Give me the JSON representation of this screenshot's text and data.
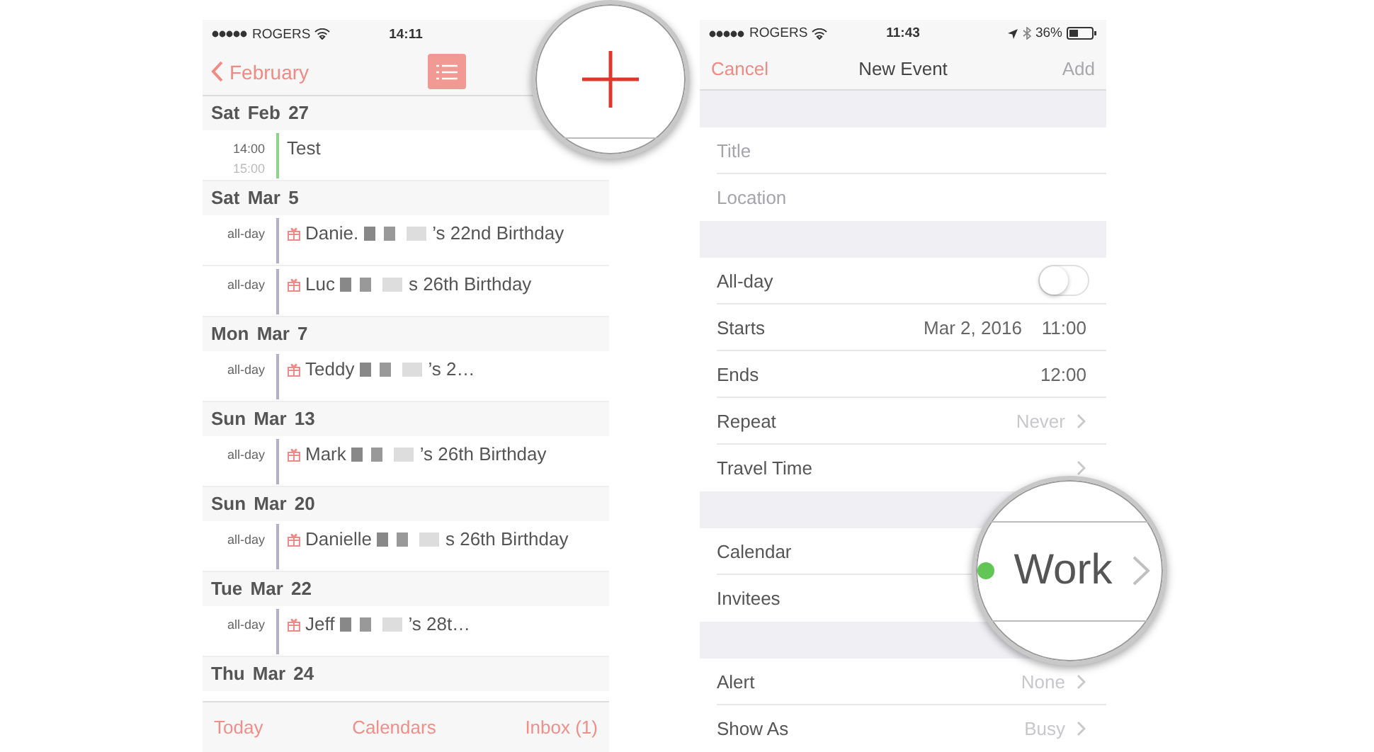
{
  "left_screen": {
    "status_bar": {
      "carrier": "ROGERS",
      "time": "14:11"
    },
    "nav": {
      "back": "February"
    },
    "days": [
      {
        "date": "Sat Feb 27",
        "events": [
          {
            "kind": "timed",
            "start": "14:00",
            "end": "15:00",
            "name": "Test",
            "color": "#8fd48a"
          }
        ]
      },
      {
        "date": "Sat Mar 5",
        "events": [
          {
            "kind": "birthday",
            "time": "all-day",
            "name": "Danie.",
            "rest": "’s 22nd Birthday",
            "color": "#b4aec9"
          },
          {
            "kind": "birthday",
            "time": "all-day",
            "name": "Luc",
            "rest": "s 26th Birthday",
            "color": "#b4aec9"
          }
        ]
      },
      {
        "date": "Mon Mar 7",
        "events": [
          {
            "kind": "birthday",
            "time": "all-day",
            "name": "Teddy",
            "rest": "’s 2…",
            "color": "#b4aec9"
          }
        ]
      },
      {
        "date": "Sun Mar 13",
        "events": [
          {
            "kind": "birthday",
            "time": "all-day",
            "name": "Mark",
            "rest": "’s 26th Birthday",
            "color": "#b4aec9"
          }
        ]
      },
      {
        "date": "Sun Mar 20",
        "events": [
          {
            "kind": "birthday",
            "time": "all-day",
            "name": "Danielle",
            "rest": "s 26th Birthday",
            "color": "#b4aec9"
          }
        ]
      },
      {
        "date": "Tue Mar 22",
        "events": [
          {
            "kind": "birthday",
            "time": "all-day",
            "name": "Jeff",
            "rest": "’s 28t…",
            "color": "#b4aec9"
          }
        ]
      },
      {
        "date": "Thu Mar 24"
      }
    ],
    "tabs": [
      {
        "label": "Today"
      },
      {
        "label": "Calendars"
      },
      {
        "label": "Inbox (1)"
      }
    ]
  },
  "right_screen": {
    "status_bar": {
      "carrier": "ROGERS",
      "time": "11:43",
      "battery": "36%"
    },
    "nav": {
      "cancel": "Cancel",
      "title": "New Event",
      "add": "Add",
      "add_disabled": true
    },
    "groups": [
      [
        {
          "kind": "field",
          "placeholder": "Title"
        },
        {
          "kind": "field",
          "placeholder": "Location"
        }
      ],
      [
        {
          "kind": "toggle",
          "label": "All-day",
          "on": false
        },
        {
          "kind": "datetime",
          "label": "Starts",
          "date": "Mar 2, 2016",
          "time": "11:00"
        },
        {
          "kind": "datetime",
          "label": "Ends",
          "time": "12:00"
        },
        {
          "kind": "disclosure",
          "label": "Repeat",
          "value": "Never"
        },
        {
          "kind": "disclosure",
          "label": "Travel Time"
        }
      ],
      [
        {
          "kind": "disclosure",
          "label": "Calendar"
        },
        {
          "kind": "disclosure",
          "label": "Invitees"
        }
      ],
      [
        {
          "kind": "disclosure",
          "label": "Alert",
          "value": "None"
        },
        {
          "kind": "disclosure",
          "label": "Show As",
          "value": "Busy"
        }
      ]
    ],
    "calendar_lens": {
      "value": "Work",
      "color": "#62c655"
    }
  }
}
